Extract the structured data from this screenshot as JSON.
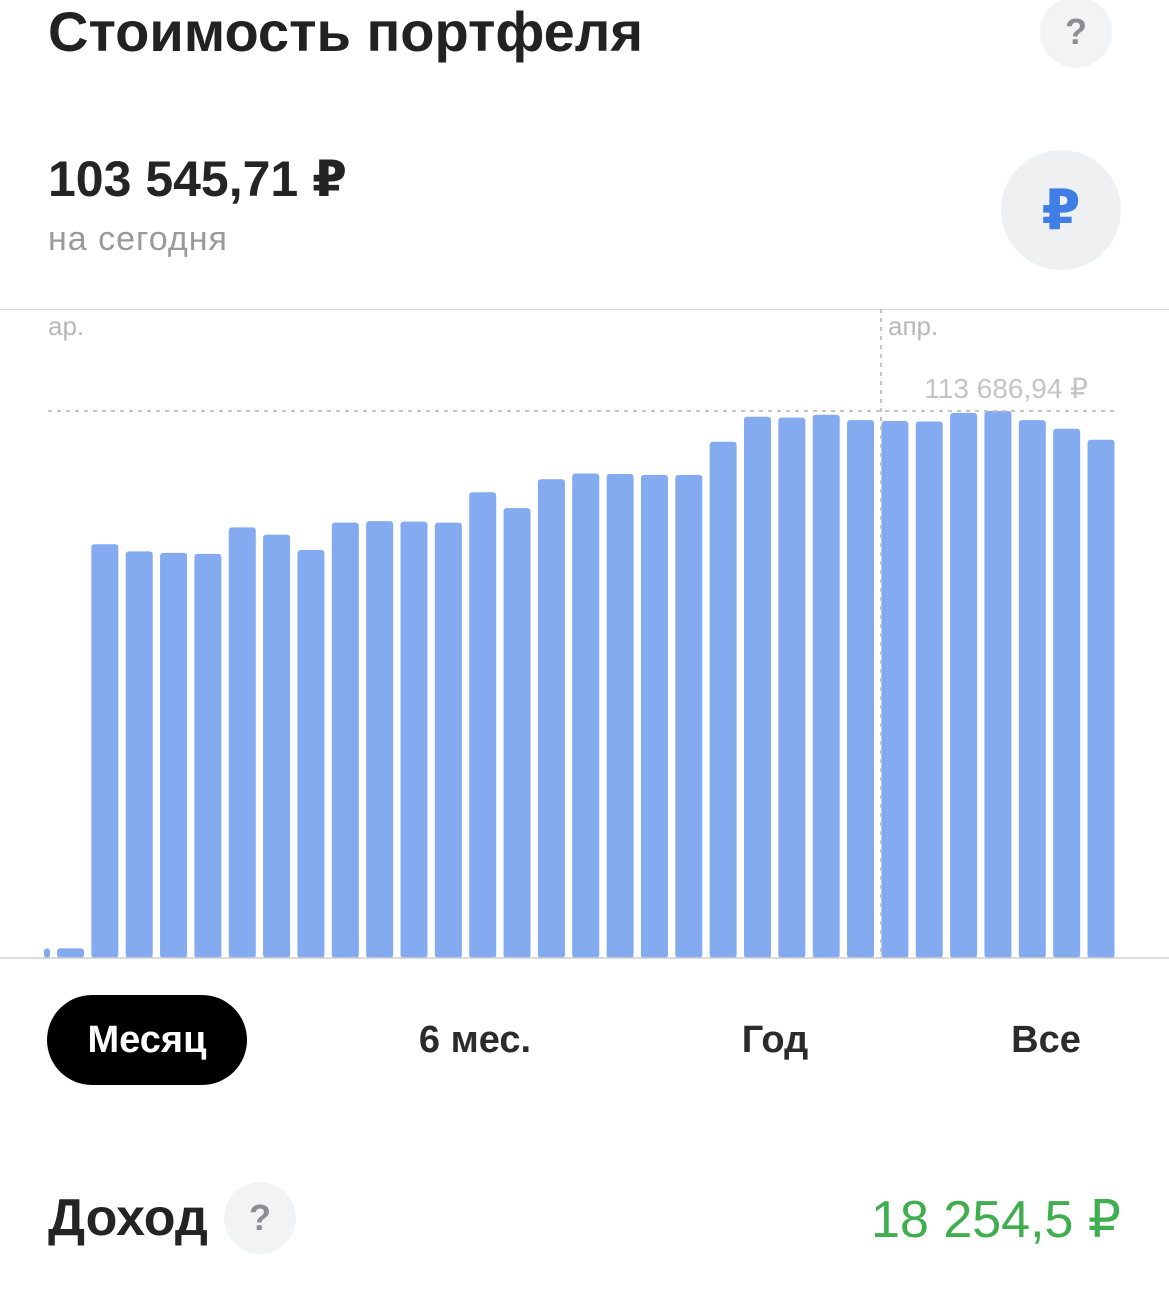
{
  "header": {
    "title": "Стоимость портфеля",
    "help_icon": "?"
  },
  "portfolio": {
    "value": "103 545,71 ₽",
    "caption": "на сегодня",
    "currency_symbol": "₽"
  },
  "chart_data": {
    "type": "bar",
    "x_labels": [
      "ар.",
      "апр."
    ],
    "highlight_value_label": "113 686,94 ₽",
    "values": [
      2,
      2,
      86,
      84.5,
      84.2,
      84,
      89.5,
      88,
      84.8,
      90.5,
      90.8,
      90.7,
      90.5,
      96.8,
      93.5,
      99.5,
      100.7,
      100.6,
      100.4,
      100.4,
      107.3,
      112.5,
      112.3,
      112.9,
      111.8,
      111.6,
      111.5,
      113.3,
      113.7,
      111.8,
      110.0,
      107.7
    ],
    "highlight_value": 113686.94,
    "color": "#84aaf0"
  },
  "periods": [
    {
      "label": "Месяц",
      "active": true
    },
    {
      "label": "6 мес.",
      "active": false
    },
    {
      "label": "Год",
      "active": false
    },
    {
      "label": "Все",
      "active": false
    }
  ],
  "income": {
    "title": "Доход",
    "help_icon": "?",
    "value": "18 254,5 ₽",
    "value_color": "#3fae4f"
  }
}
